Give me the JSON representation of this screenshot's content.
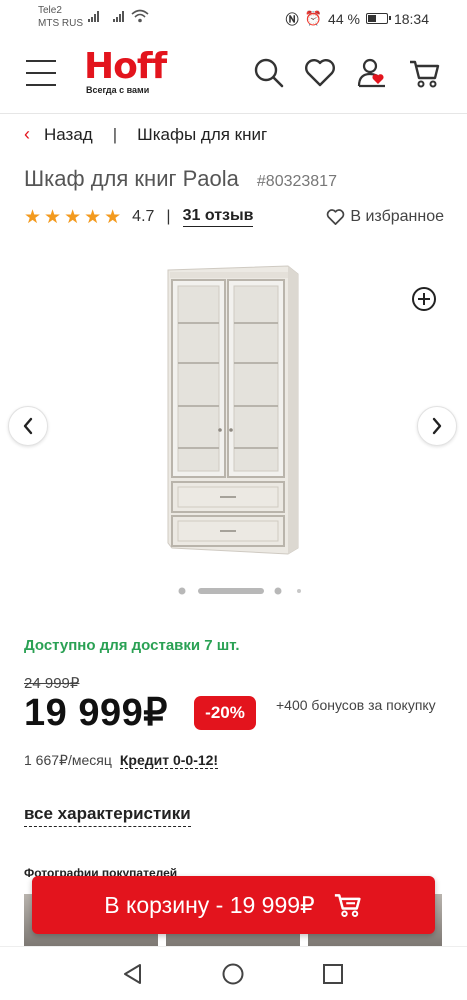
{
  "status_bar": {
    "carrier_1": "Tele2",
    "carrier_2": "MTS RUS",
    "battery": "44 %",
    "time": "18:34"
  },
  "header": {
    "logo_text": "Hoff",
    "logo_tagline": "Всегда с вами",
    "icons": [
      "menu-icon",
      "search-icon",
      "heart-icon",
      "user-icon",
      "cart-icon"
    ],
    "brand_color": "#e3141d"
  },
  "breadcrumb": {
    "back_label": "Назад",
    "separator": "|",
    "category": "Шкафы для книг"
  },
  "product": {
    "title": "Шкаф для книг Paola",
    "sku": "#80323817",
    "stars": "★★★★★",
    "rating": "4.7",
    "reviews": "31 отзыв",
    "favorite_label": "В избранное"
  },
  "gallery": {
    "total_slides": 4,
    "active_slide": 2
  },
  "pricing": {
    "availability": "Доступно для доставки 7 шт.",
    "availability_color": "#2aa154",
    "old_price": "24 999₽",
    "price": "19 999₽",
    "discount": "-20%",
    "bonus": "+400 бонусов за покупку",
    "monthly": "1 667₽/месяц",
    "credit_label": "Кредит 0-0-12!"
  },
  "specs_link": "все характеристики",
  "photos_title": "Фотографии покупателей",
  "cart_button": {
    "label": "В корзину - 19 999₽"
  },
  "system_nav": [
    "back-icon",
    "home-icon",
    "recents-icon"
  ]
}
